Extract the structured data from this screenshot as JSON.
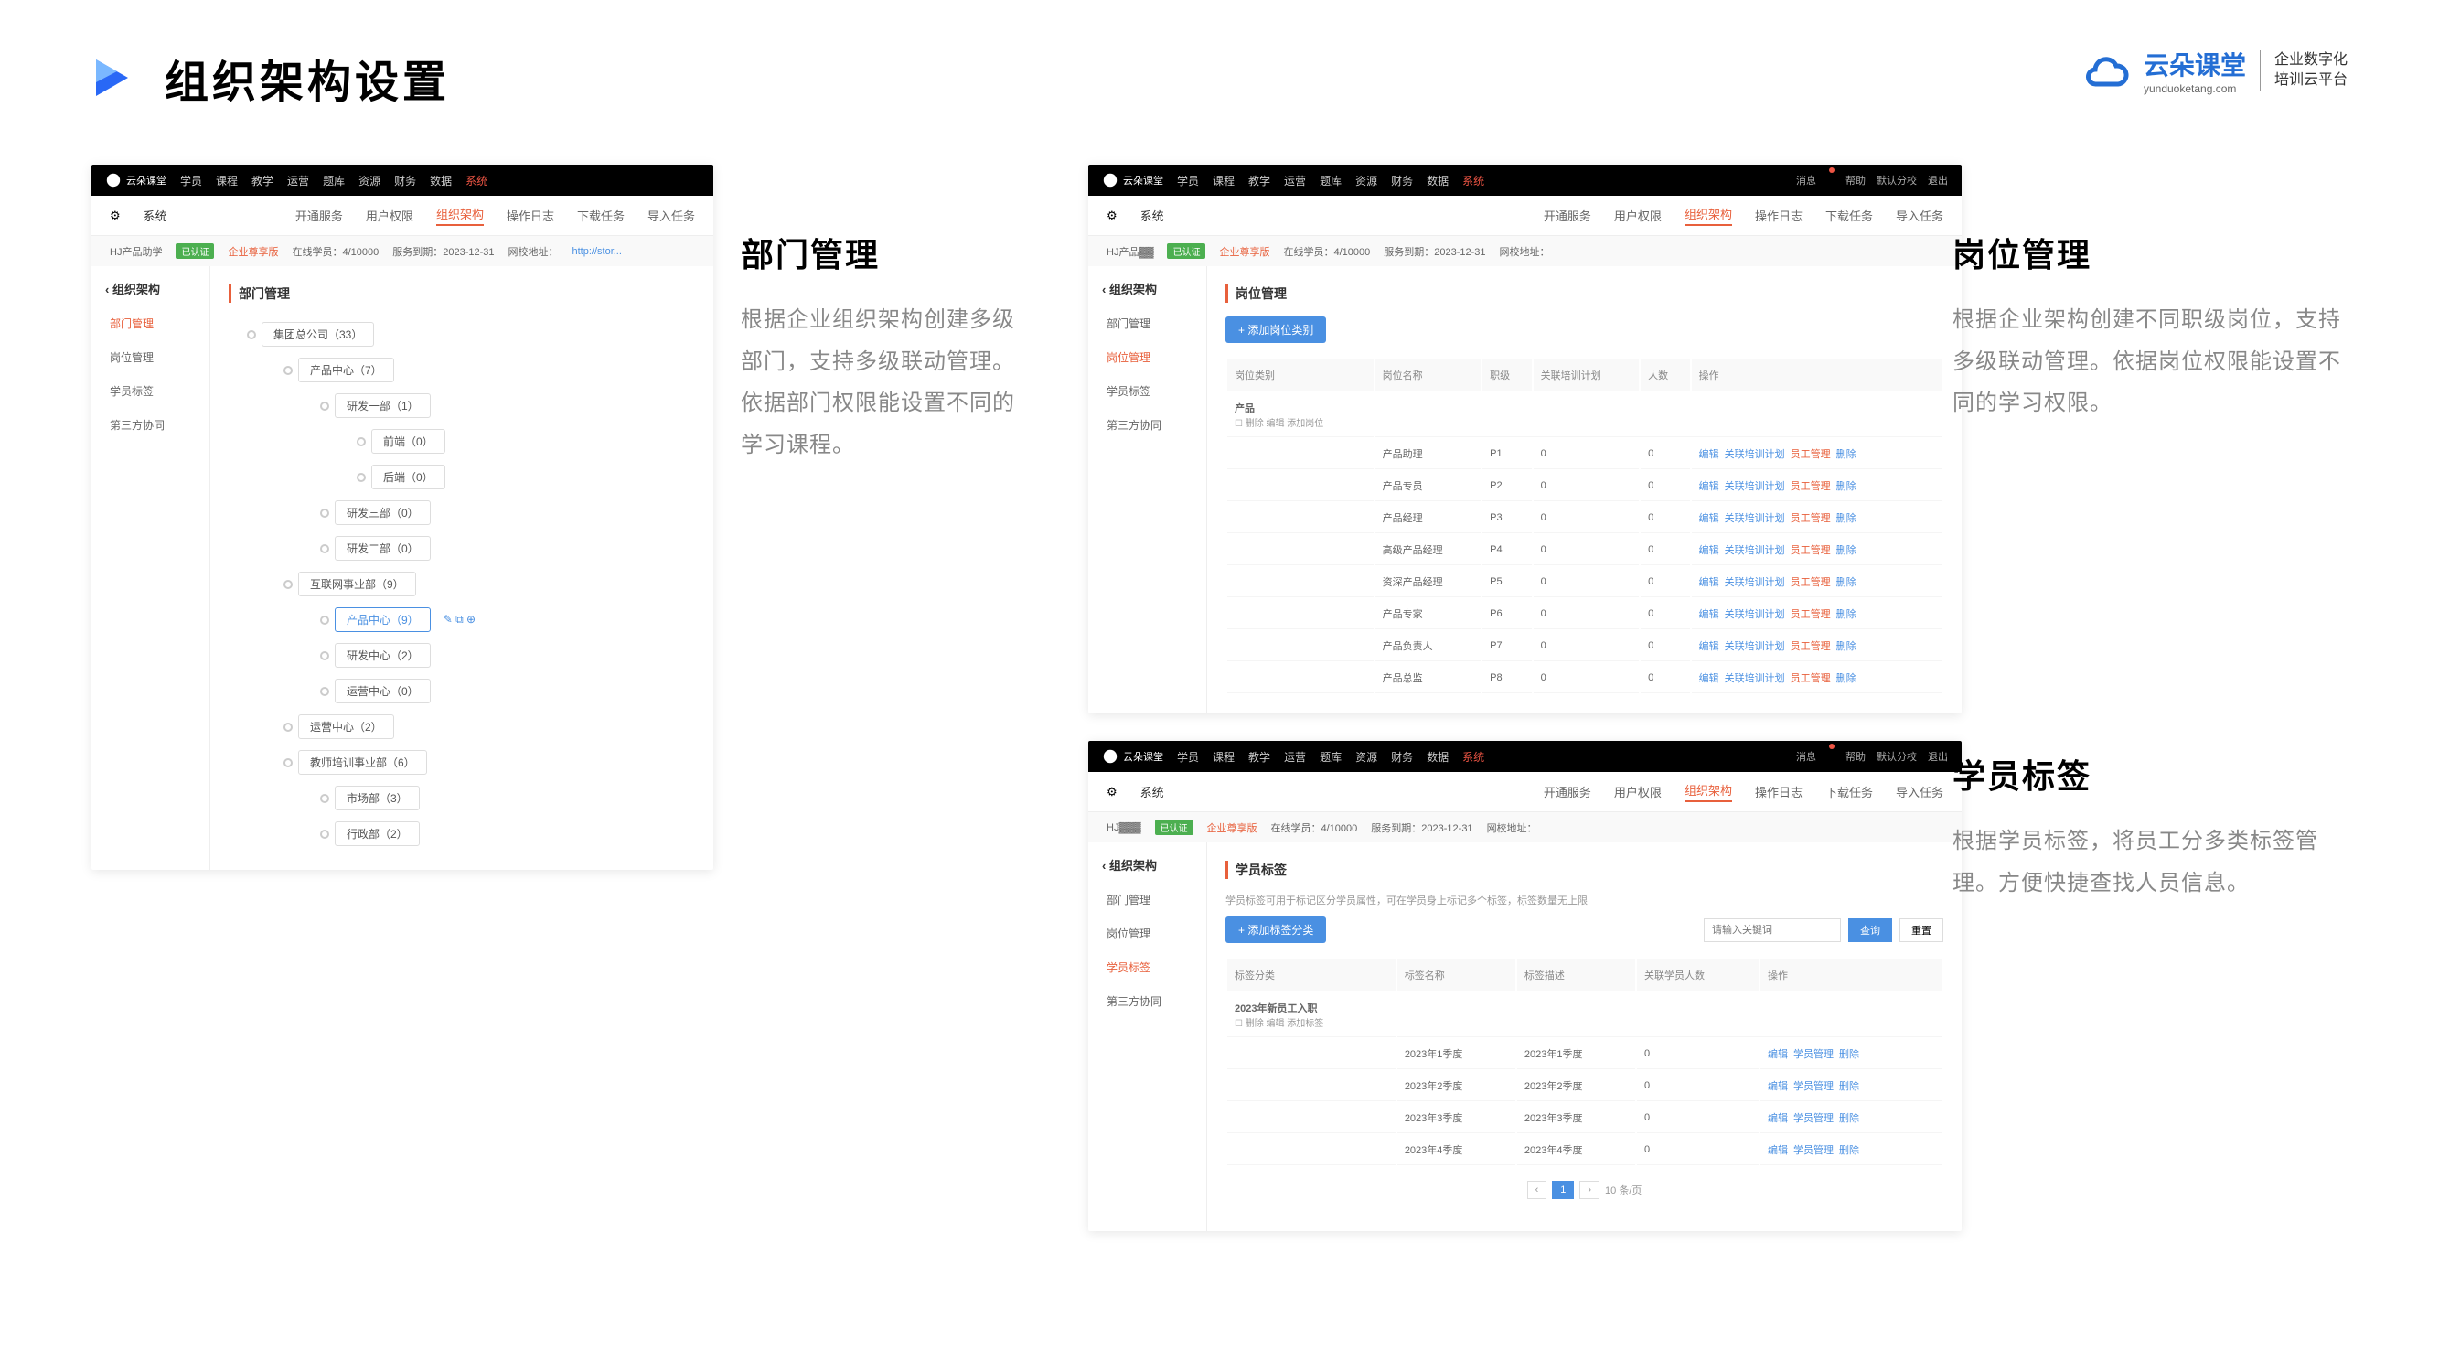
{
  "header": {
    "title": "组织架构设置"
  },
  "brand": {
    "name": "云朵课堂",
    "sub": "yunduoketang.com",
    "tagline1": "企业数字化",
    "tagline2": "培训云平台"
  },
  "topnav": {
    "items": [
      "学员",
      "课程",
      "教学",
      "运营",
      "题库",
      "资源",
      "财务",
      "数据",
      "系统"
    ],
    "right": [
      "消息",
      "帮助",
      "默认分校",
      "退出"
    ]
  },
  "subnav": {
    "sys": "系统",
    "items": [
      "开通服务",
      "用户权限",
      "组织架构",
      "操作日志",
      "下载任务",
      "导入任务"
    ],
    "active": "组织架构"
  },
  "info": {
    "company": "HJ产品助学",
    "badge": "已认证",
    "plan": "企业尊享版",
    "online": "在线学员：4/10000",
    "expire": "服务到期：2023-12-31",
    "url": "网校地址："
  },
  "sidebar": {
    "title": "组织架构",
    "items": [
      "部门管理",
      "岗位管理",
      "学员标签",
      "第三方协同"
    ]
  },
  "shot1": {
    "title": "部门管理",
    "tree": [
      {
        "lvl": 1,
        "label": "集团总公司（33）"
      },
      {
        "lvl": 2,
        "label": "产品中心（7）"
      },
      {
        "lvl": 3,
        "label": "研发一部（1）"
      },
      {
        "lvl": 4,
        "label": "前端（0）"
      },
      {
        "lvl": 4,
        "label": "后端（0）"
      },
      {
        "lvl": 3,
        "label": "研发三部（0）"
      },
      {
        "lvl": 3,
        "label": "研发二部（0）"
      },
      {
        "lvl": 2,
        "label": "互联网事业部（9）"
      },
      {
        "lvl": 3,
        "label": "产品中心（9）",
        "hl": true,
        "icons": true
      },
      {
        "lvl": 3,
        "label": "研发中心（2）"
      },
      {
        "lvl": 3,
        "label": "运营中心（0）"
      },
      {
        "lvl": 2,
        "label": "运营中心（2）"
      },
      {
        "lvl": 2,
        "label": "教师培训事业部（6）"
      },
      {
        "lvl": 3,
        "label": "市场部（3）"
      },
      {
        "lvl": 3,
        "label": "行政部（2）"
      }
    ]
  },
  "desc1": {
    "title": "部门管理",
    "body": "根据企业组织架构创建多级部门，支持多级联动管理。依据部门权限能设置不同的学习课程。"
  },
  "shot2": {
    "title": "岗位管理",
    "add": "+ 添加岗位类别",
    "cols": [
      "岗位类别",
      "岗位名称",
      "职级",
      "关联培训计划",
      "人数",
      "操作"
    ],
    "catRow": {
      "cat": "产品",
      "sub": "删除  编辑  添加岗位"
    },
    "rows": [
      {
        "name": "产品助理",
        "level": "P1",
        "plan": "0",
        "count": "0"
      },
      {
        "name": "产品专员",
        "level": "P2",
        "plan": "0",
        "count": "0"
      },
      {
        "name": "产品经理",
        "level": "P3",
        "plan": "0",
        "count": "0"
      },
      {
        "name": "高级产品经理",
        "level": "P4",
        "plan": "0",
        "count": "0"
      },
      {
        "name": "资深产品经理",
        "level": "P5",
        "plan": "0",
        "count": "0"
      },
      {
        "name": "产品专家",
        "level": "P6",
        "plan": "0",
        "count": "0"
      },
      {
        "name": "产品负责人",
        "level": "P7",
        "plan": "0",
        "count": "0"
      },
      {
        "name": "产品总监",
        "level": "P8",
        "plan": "0",
        "count": "0"
      }
    ],
    "ops": {
      "edit": "编辑",
      "plan": "关联培训计划",
      "mgr": "员工管理",
      "del": "删除"
    }
  },
  "desc2": {
    "title": "岗位管理",
    "body": "根据企业架构创建不同职级岗位，支持多级联动管理。依据岗位权限能设置不同的学习权限。"
  },
  "shot3": {
    "title": "学员标签",
    "helper": "学员标签可用于标记区分学员属性，可在学员身上标记多个标签，标签数量无上限",
    "add": "+ 添加标签分类",
    "search": {
      "ph": "请输入关键词",
      "q": "查询",
      "r": "重置"
    },
    "cols": [
      "标签分类",
      "标签名称",
      "标签描述",
      "关联学员人数",
      "操作"
    ],
    "catRow": {
      "cat": "2023年新员工入职",
      "sub": "删除  编辑  添加标签"
    },
    "rows": [
      {
        "name": "2023年1季度",
        "desc": "2023年1季度",
        "count": "0"
      },
      {
        "name": "2023年2季度",
        "desc": "2023年2季度",
        "count": "0"
      },
      {
        "name": "2023年3季度",
        "desc": "2023年3季度",
        "count": "0"
      },
      {
        "name": "2023年4季度",
        "desc": "2023年4季度",
        "count": "0"
      }
    ],
    "ops": {
      "edit": "编辑",
      "mgr": "学员管理",
      "del": "删除"
    },
    "pager": {
      "page": "1",
      "size": "10 条/页"
    }
  },
  "desc3": {
    "title": "学员标签",
    "body": "根据学员标签，将员工分多类标签管理。方便快捷查找人员信息。"
  }
}
